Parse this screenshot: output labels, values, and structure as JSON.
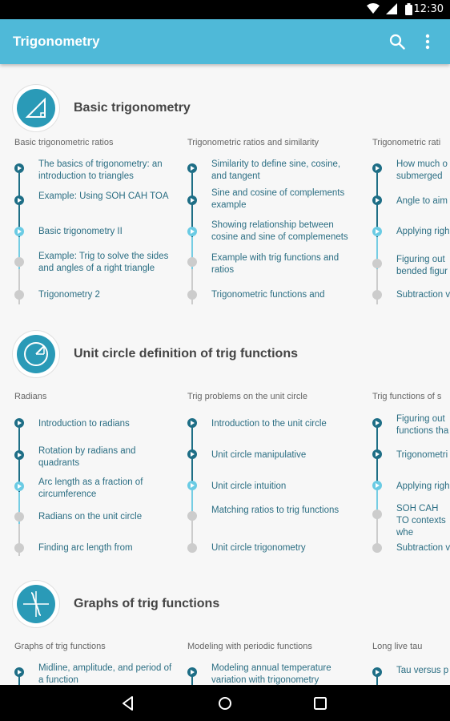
{
  "status_bar": {
    "time": "12:30"
  },
  "app_bar": {
    "title": "Trigonometry"
  },
  "sections": [
    {
      "title": "Basic trigonometry",
      "columns": [
        {
          "title": "Basic trigonometric ratios",
          "items": [
            {
              "label": "The basics of trigonometry: an introduction to triangles",
              "state": "done"
            },
            {
              "label": "Example: Using SOH CAH TOA",
              "state": "done"
            },
            {
              "label": "Basic trigonometry II",
              "state": "current"
            },
            {
              "label": "Example: Trig to solve the sides and angles of a right triangle",
              "state": "todo"
            },
            {
              "label": "Trigonometry 2",
              "state": "todo"
            }
          ]
        },
        {
          "title": "Trigonometric ratios and similarity",
          "items": [
            {
              "label": "Similarity to define sine, cosine, and tangent",
              "state": "done"
            },
            {
              "label": "Sine and cosine of complements example",
              "state": "done"
            },
            {
              "label": "Showing relationship between cosine and sine of complemenets",
              "state": "current"
            },
            {
              "label": "Example with trig functions and ratios",
              "state": "todo"
            },
            {
              "label": "Trigonometric functions and",
              "state": "todo"
            }
          ]
        },
        {
          "title": "Trigonometric rati",
          "items": [
            {
              "label": "How much o submerged",
              "state": "done"
            },
            {
              "label": "Angle to aim",
              "state": "done"
            },
            {
              "label": "Applying righ",
              "state": "current"
            },
            {
              "label": "Figuring out bended figur",
              "state": "todo"
            },
            {
              "label": "Subtraction v",
              "state": "todo"
            }
          ]
        }
      ]
    },
    {
      "title": "Unit circle definition of trig functions",
      "columns": [
        {
          "title": "Radians",
          "items": [
            {
              "label": "Introduction to radians",
              "state": "done"
            },
            {
              "label": "Rotation by radians and quadrants",
              "state": "done"
            },
            {
              "label": "Arc length as a fraction of circumference",
              "state": "current"
            },
            {
              "label": "Radians on the unit circle",
              "state": "todo"
            },
            {
              "label": "Finding arc length from",
              "state": "todo"
            }
          ]
        },
        {
          "title": "Trig problems on the unit circle",
          "items": [
            {
              "label": "Introduction to the unit circle",
              "state": "done"
            },
            {
              "label": "Unit circle manipulative",
              "state": "done"
            },
            {
              "label": "Unit circle intuition",
              "state": "current"
            },
            {
              "label": "Matching ratios to trig functions",
              "state": "todo"
            },
            {
              "label": "Unit circle trigonometry",
              "state": "todo"
            }
          ]
        },
        {
          "title": "Trig functions of s",
          "items": [
            {
              "label": "Figuring out functions tha",
              "state": "done"
            },
            {
              "label": "Trigonometri",
              "state": "done"
            },
            {
              "label": "Applying righ",
              "state": "current"
            },
            {
              "label": "SOH CAH TO contexts whe",
              "state": "todo"
            },
            {
              "label": "Subtraction v",
              "state": "todo"
            }
          ]
        }
      ]
    },
    {
      "title": "Graphs of trig functions",
      "columns": [
        {
          "title": "Graphs of trig functions",
          "items": [
            {
              "label": "Midline, amplitude, and period of a function",
              "state": "done"
            }
          ]
        },
        {
          "title": "Modeling with periodic functions",
          "items": [
            {
              "label": "Modeling annual temperature variation with trigonometry",
              "state": "done"
            }
          ]
        },
        {
          "title": "Long live tau",
          "items": [
            {
              "label": "Tau versus p",
              "state": "done"
            }
          ]
        }
      ]
    }
  ]
}
